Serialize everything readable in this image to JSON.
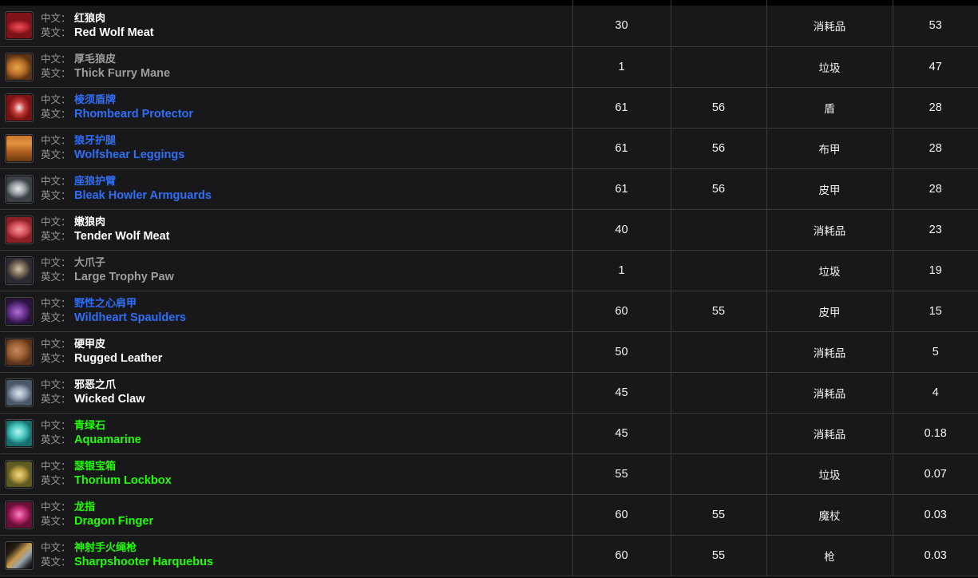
{
  "table": {
    "labels": {
      "cn": "中文：",
      "en": "英文："
    },
    "columns": [
      {
        "key": "name",
        "header": ""
      },
      {
        "key": "level",
        "header": ""
      },
      {
        "key": "req",
        "header": ""
      },
      {
        "key": "type",
        "header": ""
      },
      {
        "key": "value",
        "header": ""
      }
    ],
    "quality_colors": {
      "common": "#ffffff",
      "poor": "#9d9d9d",
      "uncommon": "#1eff00",
      "rare": "#2f6ef7"
    },
    "rows": [
      {
        "icon": "red-wolf-meat-icon",
        "cn": "红狼肉",
        "en": "Red Wolf Meat",
        "quality": "common",
        "level": "30",
        "req": "",
        "type": "消耗品",
        "value": "53"
      },
      {
        "icon": "thick-furry-mane-icon",
        "cn": "厚毛狼皮",
        "en": "Thick Furry Mane",
        "quality": "poor",
        "level": "1",
        "req": "",
        "type": "垃圾",
        "value": "47"
      },
      {
        "icon": "rhombeard-protector-icon",
        "cn": "棱须盾牌",
        "en": "Rhombeard Protector",
        "quality": "rare",
        "level": "61",
        "req": "56",
        "type": "盾",
        "value": "28"
      },
      {
        "icon": "wolfshear-leggings-icon",
        "cn": "狼牙护腿",
        "en": "Wolfshear Leggings",
        "quality": "rare",
        "level": "61",
        "req": "56",
        "type": "布甲",
        "value": "28"
      },
      {
        "icon": "bleak-howler-armguards-icon",
        "cn": "座狼护臂",
        "en": "Bleak Howler Armguards",
        "quality": "rare",
        "level": "61",
        "req": "56",
        "type": "皮甲",
        "value": "28"
      },
      {
        "icon": "tender-wolf-meat-icon",
        "cn": "嫩狼肉",
        "en": "Tender Wolf Meat",
        "quality": "common",
        "level": "40",
        "req": "",
        "type": "消耗品",
        "value": "23"
      },
      {
        "icon": "large-trophy-paw-icon",
        "cn": "大爪子",
        "en": "Large Trophy Paw",
        "quality": "poor",
        "level": "1",
        "req": "",
        "type": "垃圾",
        "value": "19"
      },
      {
        "icon": "wildheart-spaulders-icon",
        "cn": "野性之心肩甲",
        "en": "Wildheart Spaulders",
        "quality": "rare",
        "level": "60",
        "req": "55",
        "type": "皮甲",
        "value": "15"
      },
      {
        "icon": "rugged-leather-icon",
        "cn": "硬甲皮",
        "en": "Rugged Leather",
        "quality": "common",
        "level": "50",
        "req": "",
        "type": "消耗品",
        "value": "5"
      },
      {
        "icon": "wicked-claw-icon",
        "cn": "邪恶之爪",
        "en": "Wicked Claw",
        "quality": "common",
        "level": "45",
        "req": "",
        "type": "消耗品",
        "value": "4"
      },
      {
        "icon": "aquamarine-icon",
        "cn": "青绿石",
        "en": "Aquamarine",
        "quality": "uncommon",
        "level": "45",
        "req": "",
        "type": "消耗品",
        "value": "0.18"
      },
      {
        "icon": "thorium-lockbox-icon",
        "cn": "瑟银宝箱",
        "en": "Thorium Lockbox",
        "quality": "uncommon",
        "level": "55",
        "req": "",
        "type": "垃圾",
        "value": "0.07"
      },
      {
        "icon": "dragon-finger-icon",
        "cn": "龙指",
        "en": "Dragon Finger",
        "quality": "uncommon",
        "level": "60",
        "req": "55",
        "type": "魔杖",
        "value": "0.03"
      },
      {
        "icon": "sharpshooter-harquebus-icon",
        "cn": "神射手火绳枪",
        "en": "Sharpshooter Harquebus",
        "quality": "uncommon",
        "level": "60",
        "req": "55",
        "type": "枪",
        "value": "0.03"
      }
    ]
  }
}
